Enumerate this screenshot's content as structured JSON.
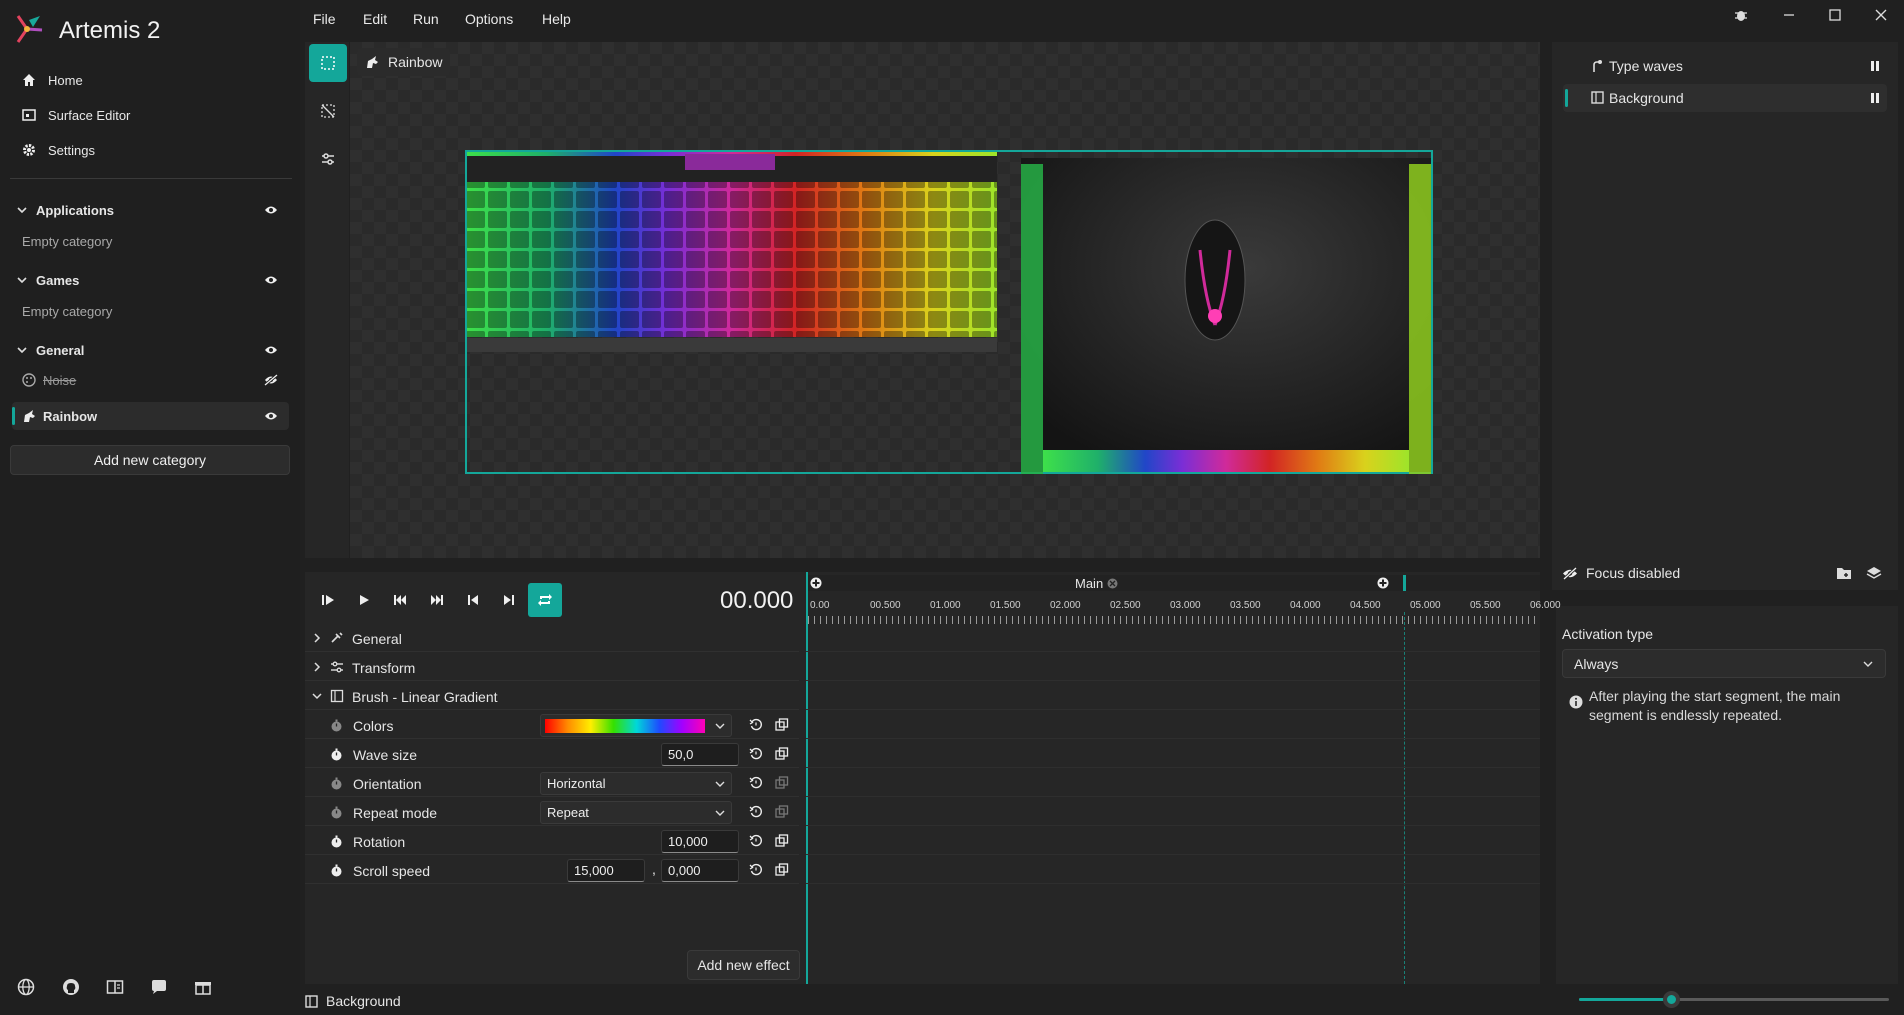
{
  "app": {
    "title": "Artemis 2"
  },
  "menu": [
    "File",
    "Edit",
    "Run",
    "Options",
    "Help"
  ],
  "sidebar": {
    "nav": [
      {
        "label": "Home",
        "icon": "home-icon"
      },
      {
        "label": "Surface Editor",
        "icon": "surface-editor-icon"
      },
      {
        "label": "Settings",
        "icon": "gear-icon"
      }
    ],
    "categories": [
      {
        "name": "Applications",
        "empty_text": "Empty category"
      },
      {
        "name": "Games",
        "empty_text": "Empty category"
      },
      {
        "name": "General"
      }
    ],
    "profiles": [
      {
        "name": "Noise",
        "disabled": true
      },
      {
        "name": "Rainbow",
        "active": true
      }
    ],
    "add_category_label": "Add new category",
    "footer_icons": [
      "globe-icon",
      "github-icon",
      "wiki-icon",
      "chat-icon",
      "gift-icon"
    ]
  },
  "editor": {
    "profile_name": "Rainbow",
    "tools": [
      "select-icon",
      "deselect-icon",
      "transform-icon"
    ]
  },
  "layers": {
    "items": [
      {
        "name": "Type waves",
        "icon": "type-waves-icon"
      },
      {
        "name": "Background",
        "icon": "layer-icon",
        "selected": true
      }
    ],
    "focus_label": "Focus disabled"
  },
  "activation": {
    "title": "Activation type",
    "value": "Always",
    "info": "After playing the start segment, the main segment is endlessly repeated."
  },
  "timeline": {
    "time": "00.000",
    "segment": "Main",
    "ticks": [
      "0.00",
      "00.500",
      "01.000",
      "01.500",
      "02.000",
      "02.500",
      "03.000",
      "03.500",
      "04.000",
      "04.500",
      "05.000",
      "05.500",
      "06.000"
    ],
    "end_marker_ratio": 0.818
  },
  "properties": {
    "groups": [
      {
        "label": "General",
        "icon": "tools-icon",
        "expanded": false
      },
      {
        "label": "Transform",
        "icon": "transform-icon",
        "expanded": false
      },
      {
        "label": "Brush - Linear Gradient",
        "icon": "brush-icon",
        "expanded": true
      }
    ],
    "rows": [
      {
        "label": "Colors",
        "kind": "gradient"
      },
      {
        "label": "Wave size",
        "kind": "number",
        "value": "50,0"
      },
      {
        "label": "Orientation",
        "kind": "select",
        "value": "Horizontal"
      },
      {
        "label": "Repeat mode",
        "kind": "select",
        "value": "Repeat"
      },
      {
        "label": "Rotation",
        "kind": "number",
        "value": "10,000"
      },
      {
        "label": "Scroll speed",
        "kind": "pair",
        "value": "15,000",
        "value2": "0,000"
      }
    ],
    "add_effect_label": "Add new effect"
  },
  "status": {
    "layer": "Background"
  },
  "colors": {
    "accent": "#14a79a",
    "accent_dark": "#0e8a7f"
  }
}
